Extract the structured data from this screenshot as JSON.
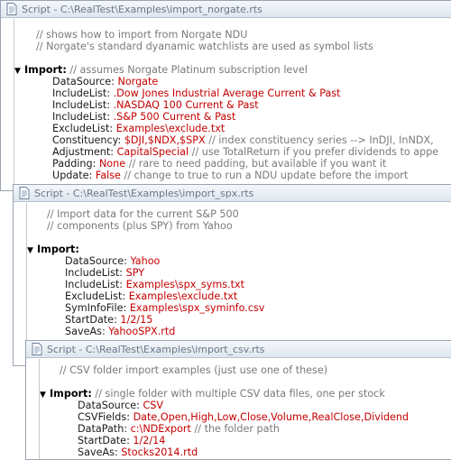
{
  "windows": {
    "norgate": {
      "title": "Script - C:\\RealTest\\Examples\\import_norgate.rts",
      "comment1": "// shows how to import from Norgate NDU",
      "comment2": "// Norgate's standard dyanamic watchlists are used as symbol lists",
      "section": "Import:",
      "section_comment": "// assumes Norgate Platinum subscription level",
      "props": [
        {
          "key": "DataSource:",
          "val": "Norgate",
          "comment": ""
        },
        {
          "key": "IncludeList:",
          "val": ".Dow Jones Industrial Average Current & Past",
          "comment": ""
        },
        {
          "key": "IncludeList:",
          "val": ".NASDAQ 100 Current & Past",
          "comment": ""
        },
        {
          "key": "IncludeList:",
          "val": ".S&P 500 Current & Past",
          "comment": ""
        },
        {
          "key": "ExcludeList:",
          "val": "Examples\\exclude.txt",
          "comment": ""
        },
        {
          "key": "Constituency:",
          "val": "$DJI,$NDX,$SPX",
          "comment": "// index constituency series --> InDJI, InNDX,"
        },
        {
          "key": "Adjustment:",
          "val": "CapitalSpecial",
          "comment": "// use TotalReturn if you prefer dividends to appe"
        },
        {
          "key": "Padding:",
          "val": "None",
          "comment": "// rare to need padding, but available if you want it"
        },
        {
          "key": "Update:",
          "val": "False",
          "comment": "// change to true to run a NDU update before the import"
        }
      ]
    },
    "spx": {
      "title": "Script - C:\\RealTest\\Examples\\import_spx.rts",
      "comment1": "// Import data for the current S&P 500",
      "comment2": "// components (plus SPY) from Yahoo",
      "section": "Import:",
      "props": [
        {
          "key": "DataSource:",
          "val": "Yahoo"
        },
        {
          "key": "IncludeList:",
          "val": "SPY"
        },
        {
          "key": "IncludeList:",
          "val": "Examples\\spx_syms.txt"
        },
        {
          "key": "ExcludeList:",
          "val": "Examples\\exclude.txt"
        },
        {
          "key": "SymInfoFile:",
          "val": "Examples\\spx_syminfo.csv"
        },
        {
          "key": "StartDate:",
          "val": "1/2/15"
        },
        {
          "key": "SaveAs:",
          "val": "YahooSPX.rtd"
        }
      ]
    },
    "csv": {
      "title": "Script - C:\\RealTest\\Examples\\import_csv.rts",
      "comment1": "// CSV folder import examples (just use one of these)",
      "section": "Import:",
      "section_comment": "// single folder with multiple CSV data files, one per stock",
      "props": [
        {
          "key": "DataSource:",
          "val": "CSV",
          "comment": ""
        },
        {
          "key": "CSVFields:",
          "val": "Date,Open,High,Low,Close,Volume,RealClose,Dividend",
          "comment": ""
        },
        {
          "key": "DataPath:",
          "val": "c:\\NDExport",
          "comment": "// the folder path"
        },
        {
          "key": "StartDate:",
          "val": "1/2/14",
          "comment": ""
        },
        {
          "key": "SaveAs:",
          "val": "Stocks2014.rtd",
          "comment": ""
        }
      ]
    }
  },
  "colors": {
    "keyword": "#000000",
    "value": "#c40000",
    "comment": "#7a7a7a"
  },
  "icons": {
    "window": "script-document-icon",
    "fold": "collapse-triangle-icon"
  }
}
